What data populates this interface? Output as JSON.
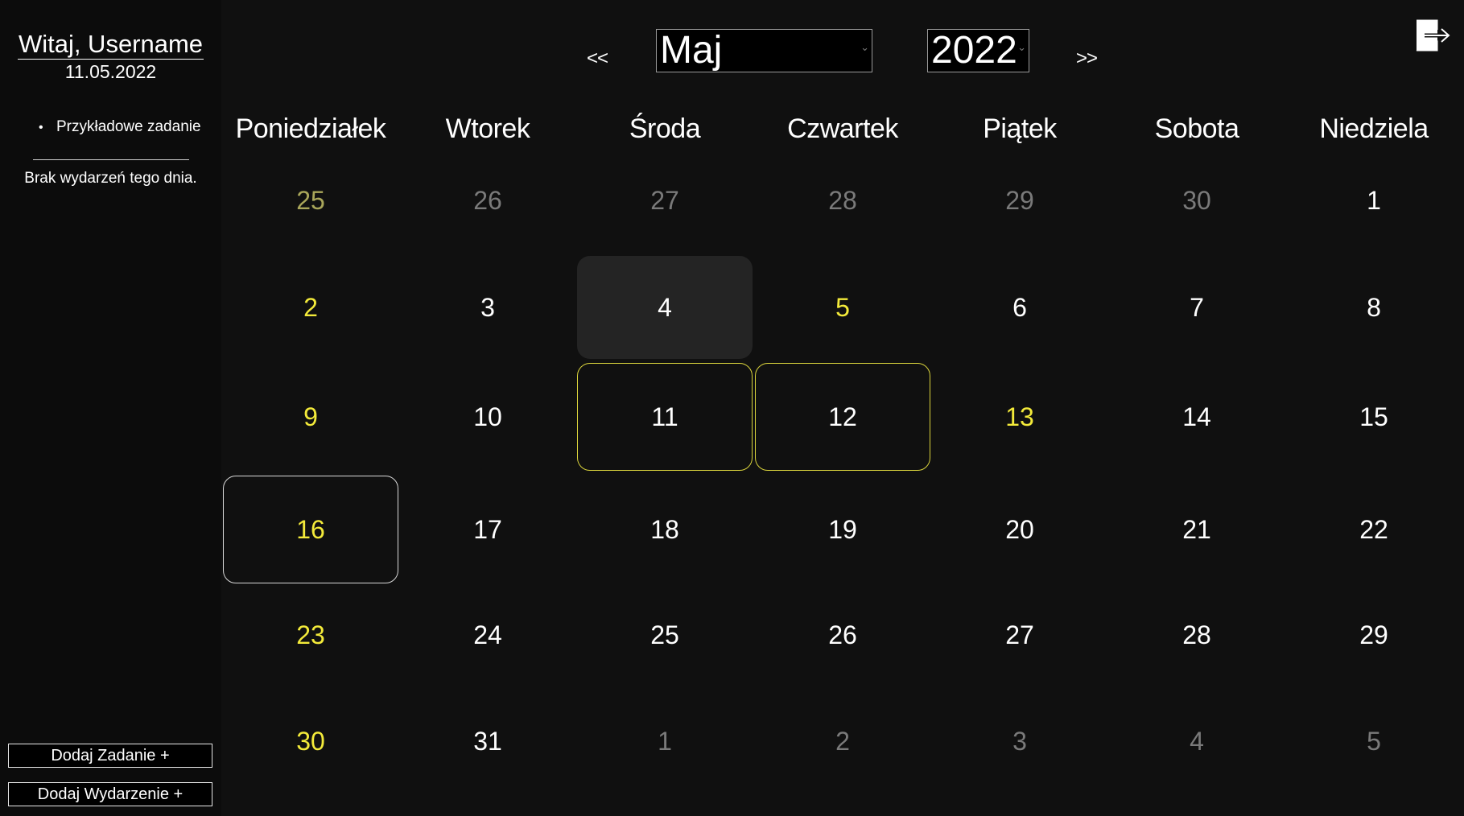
{
  "sidebar": {
    "greeting": "Witaj, Username",
    "today_date": "11.05.2022",
    "tasks": [
      "Przykładowe zadanie"
    ],
    "no_events_text": "Brak wydarzeń tego dnia.",
    "add_task_label": "Dodaj Zadanie +",
    "add_event_label": "Dodaj Wydarzenie +"
  },
  "header": {
    "prev_label": "<<",
    "next_label": ">>",
    "month": "Maj",
    "year": "2022",
    "exit_icon": "logout-icon"
  },
  "calendar": {
    "weekdays": [
      "Poniedziałek",
      "Wtorek",
      "Środa",
      "Czwartek",
      "Piątek",
      "Sobota",
      "Niedziela"
    ],
    "weeks": [
      [
        {
          "day": "25",
          "state": "other-month",
          "marked": true
        },
        {
          "day": "26",
          "state": "other-month"
        },
        {
          "day": "27",
          "state": "other-month"
        },
        {
          "day": "28",
          "state": "other-month"
        },
        {
          "day": "29",
          "state": "other-month"
        },
        {
          "day": "30",
          "state": "other-month"
        },
        {
          "day": "1",
          "state": "current"
        }
      ],
      [
        {
          "day": "2",
          "state": "current",
          "marked": true
        },
        {
          "day": "3",
          "state": "current"
        },
        {
          "day": "4",
          "state": "current",
          "hover": true
        },
        {
          "day": "5",
          "state": "current",
          "marked": true
        },
        {
          "day": "6",
          "state": "current"
        },
        {
          "day": "7",
          "state": "current"
        },
        {
          "day": "8",
          "state": "current"
        }
      ],
      [
        {
          "day": "9",
          "state": "current",
          "marked": true
        },
        {
          "day": "10",
          "state": "current"
        },
        {
          "day": "11",
          "state": "current",
          "outline": "yellow"
        },
        {
          "day": "12",
          "state": "current",
          "outline": "yellow"
        },
        {
          "day": "13",
          "state": "current",
          "marked": true
        },
        {
          "day": "14",
          "state": "current"
        },
        {
          "day": "15",
          "state": "current"
        }
      ],
      [
        {
          "day": "16",
          "state": "current",
          "marked": true,
          "outline": "white"
        },
        {
          "day": "17",
          "state": "current"
        },
        {
          "day": "18",
          "state": "current"
        },
        {
          "day": "19",
          "state": "current"
        },
        {
          "day": "20",
          "state": "current"
        },
        {
          "day": "21",
          "state": "current"
        },
        {
          "day": "22",
          "state": "current"
        }
      ],
      [
        {
          "day": "23",
          "state": "current",
          "marked": true
        },
        {
          "day": "24",
          "state": "current"
        },
        {
          "day": "25",
          "state": "current"
        },
        {
          "day": "26",
          "state": "current"
        },
        {
          "day": "27",
          "state": "current"
        },
        {
          "day": "28",
          "state": "current"
        },
        {
          "day": "29",
          "state": "current"
        }
      ],
      [
        {
          "day": "30",
          "state": "current",
          "marked": true
        },
        {
          "day": "31",
          "state": "current"
        },
        {
          "day": "1",
          "state": "other-month"
        },
        {
          "day": "2",
          "state": "other-month"
        },
        {
          "day": "3",
          "state": "other-month"
        },
        {
          "day": "4",
          "state": "other-month"
        },
        {
          "day": "5",
          "state": "other-month"
        }
      ]
    ]
  },
  "colors": {
    "background": "#101010",
    "sidebar": "#0c0c0c",
    "accent": "#f3ea3a",
    "muted": "#7a7a7a"
  }
}
